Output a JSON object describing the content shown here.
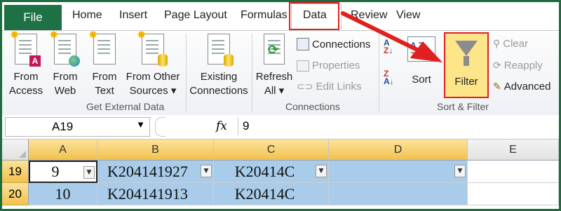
{
  "tabs": {
    "file": "File",
    "home": "Home",
    "insert": "Insert",
    "page_layout": "Page Layout",
    "formulas": "Formulas",
    "data": "Data",
    "review": "Review",
    "view": "View"
  },
  "ribbon": {
    "get_external_data": {
      "label": "Get External Data",
      "from_access": [
        "From",
        "Access"
      ],
      "from_web": [
        "From",
        "Web"
      ],
      "from_text": [
        "From",
        "Text"
      ],
      "from_other_sources": [
        "From Other",
        "Sources ▾"
      ],
      "existing_connections": [
        "Existing",
        "Connections"
      ]
    },
    "connections": {
      "label": "Connections",
      "refresh_all": [
        "Refresh",
        "All ▾"
      ],
      "connections": "Connections",
      "properties": "Properties",
      "edit_links": "Edit Links"
    },
    "sort_filter": {
      "label": "Sort & Filter",
      "sort": "Sort",
      "filter": "Filter",
      "clear": "Clear",
      "reapply": "Reapply",
      "advanced": "Advanced"
    }
  },
  "formula_bar": {
    "name_box": "A19",
    "fx": "fx",
    "value": "9"
  },
  "grid": {
    "columns": [
      "A",
      "B",
      "C",
      "D",
      "E"
    ],
    "rows": [
      {
        "num": "19",
        "cells": [
          "9",
          "K204141927",
          "K20414C",
          ""
        ]
      },
      {
        "num": "20",
        "cells": [
          "10",
          "K204141913",
          "K20414C",
          ""
        ]
      }
    ]
  },
  "colors": {
    "file_tab": "#1e7145",
    "highlight": "#e02020",
    "filter_active": "#fde58a",
    "selection": "#a8cce9"
  }
}
